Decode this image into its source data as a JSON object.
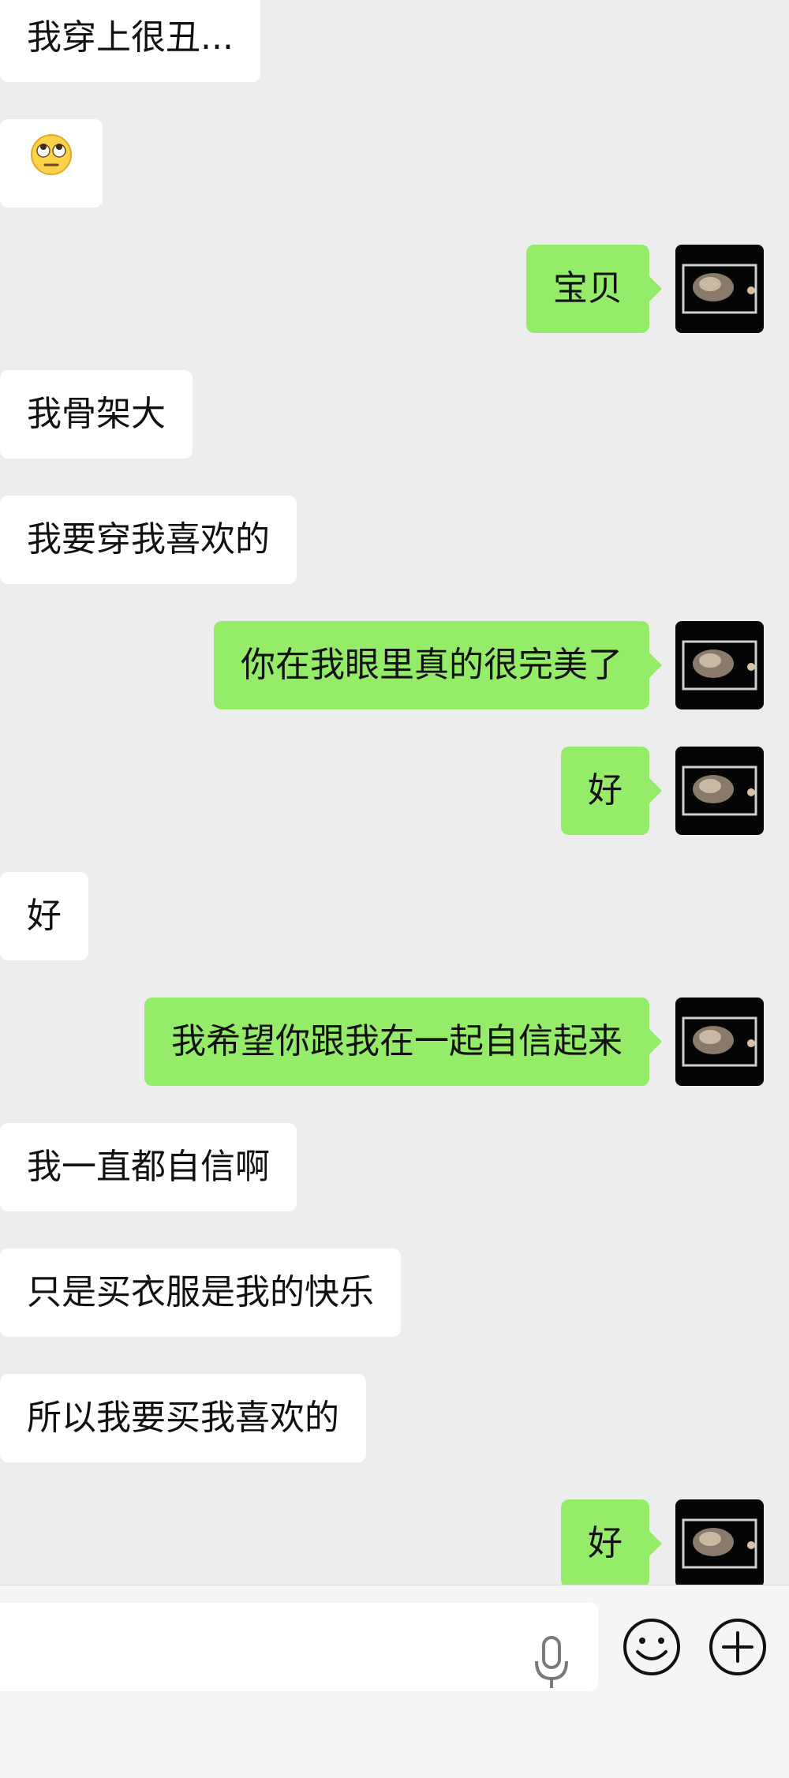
{
  "messages": [
    {
      "side": "in",
      "text": "我穿上很丑..."
    },
    {
      "side": "in",
      "text": "",
      "emoji": "eye-roll-emoji"
    },
    {
      "side": "out",
      "text": "宝贝"
    },
    {
      "side": "in",
      "text": "我骨架大"
    },
    {
      "side": "in",
      "text": "我要穿我喜欢的"
    },
    {
      "side": "out",
      "text": "你在我眼里真的很完美了"
    },
    {
      "side": "out",
      "text": "好"
    },
    {
      "side": "in",
      "text": "好"
    },
    {
      "side": "out",
      "text": "我希望你跟我在一起自信起来"
    },
    {
      "side": "in",
      "text": "我一直都自信啊"
    },
    {
      "side": "in",
      "text": "只是买衣服是我的快乐"
    },
    {
      "side": "in",
      "text": "所以我要买我喜欢的"
    },
    {
      "side": "out",
      "text": "好"
    }
  ],
  "input_bar": {
    "value": "",
    "icons": [
      "microphone-icon",
      "emoji-icon",
      "plus-icon"
    ]
  },
  "colors": {
    "background": "#ededed",
    "incoming_bubble": "#ffffff",
    "outgoing_bubble": "#95ec69"
  }
}
